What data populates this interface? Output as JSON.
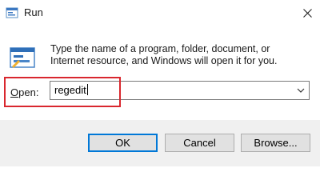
{
  "window": {
    "title": "Run",
    "close_glyph": "✕"
  },
  "description": "Type the name of a program, folder, document, or Internet resource, and Windows will open it for you.",
  "open_field": {
    "label_accel": "O",
    "label_rest": "pen:",
    "value": "regedit"
  },
  "buttons": {
    "ok": "OK",
    "cancel": "Cancel",
    "browse": "Browse..."
  },
  "icons": {
    "title": "run-app-icon",
    "dialog": "run-app-icon",
    "dropdown": "chevron-down-icon",
    "close": "close-icon"
  },
  "colors": {
    "highlight": "#d9272e",
    "default_button_border": "#0078d7",
    "button_bar": "#f0f0f0"
  }
}
